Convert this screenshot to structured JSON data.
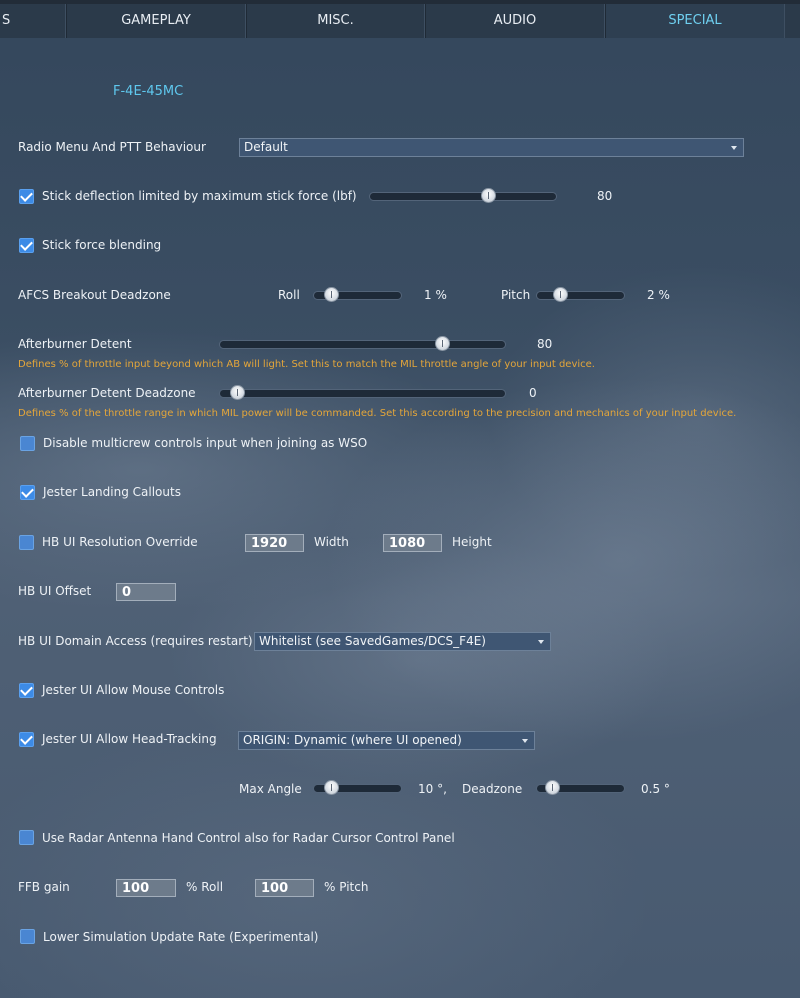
{
  "tabs": [
    {
      "label": "S",
      "active": false
    },
    {
      "label": "GAMEPLAY",
      "active": false
    },
    {
      "label": "MISC.",
      "active": false
    },
    {
      "label": "AUDIO",
      "active": false
    },
    {
      "label": "SPECIAL",
      "active": true
    }
  ],
  "aircraft": "F-4E-45MC",
  "radio_menu": {
    "label": "Radio Menu And PTT Behaviour",
    "value": "Default"
  },
  "stick_deflection": {
    "label": "Stick deflection limited by maximum stick force (lbf)",
    "checked": true,
    "value": "80",
    "fraction": 0.65
  },
  "stick_blending": {
    "label": "Stick force blending",
    "checked": true
  },
  "afcs": {
    "label": "AFCS Breakout Deadzone",
    "roll_label": "Roll",
    "roll_value": "1 %",
    "roll_fraction": 0.1,
    "pitch_label": "Pitch",
    "pitch_value": "2 %",
    "pitch_fraction": 0.2
  },
  "ab_detent": {
    "label": "Afterburner Detent",
    "value": "80",
    "fraction": 0.8,
    "hint": "Defines % of throttle input beyond which AB will light. Set this to match the MIL throttle angle of your input device."
  },
  "ab_deadzone": {
    "label": "Afterburner Detent Deadzone",
    "value": "0",
    "fraction": 0.0,
    "hint": "Defines % of the throttle range in which MIL power will be commanded. Set this according to the precision and mechanics of your input device."
  },
  "multicrew": {
    "label": "Disable multicrew controls input when joining as WSO",
    "checked": false
  },
  "jester_callouts": {
    "label": "Jester Landing Callouts",
    "checked": true
  },
  "hb_resolution": {
    "label": "HB UI Resolution Override",
    "checked": false,
    "width_value": "1920",
    "width_label": "Width",
    "height_value": "1080",
    "height_label": "Height"
  },
  "hb_offset": {
    "label": "HB UI Offset",
    "value": "0"
  },
  "hb_domain": {
    "label": "HB UI Domain Access (requires restart)",
    "value": "Whitelist (see SavedGames/DCS_F4E)"
  },
  "jester_mouse": {
    "label": "Jester UI Allow Mouse Controls",
    "checked": true
  },
  "jester_head": {
    "label": "Jester UI Allow Head-Tracking",
    "checked": true,
    "value": "ORIGIN: Dynamic (where UI opened)"
  },
  "head_track": {
    "max_angle_label": "Max Angle",
    "max_angle_value": "10 °,",
    "max_angle_fraction": 0.1,
    "deadzone_label": "Deadzone",
    "deadzone_value": "0.5 °",
    "deadzone_fraction": 0.08
  },
  "radar_antenna": {
    "label": "Use Radar Antenna Hand Control also for Radar Cursor Control Panel",
    "checked": false
  },
  "ffb": {
    "label": "FFB gain",
    "roll_value": "100",
    "roll_label": "% Roll",
    "pitch_value": "100",
    "pitch_label": "% Pitch"
  },
  "lower_sim": {
    "label": "Lower Simulation Update Rate (Experimental)",
    "checked": false
  },
  "colors": {
    "accent": "#5fc8ee",
    "hint": "#e4a63a",
    "checkbox": "#3d8be6"
  }
}
